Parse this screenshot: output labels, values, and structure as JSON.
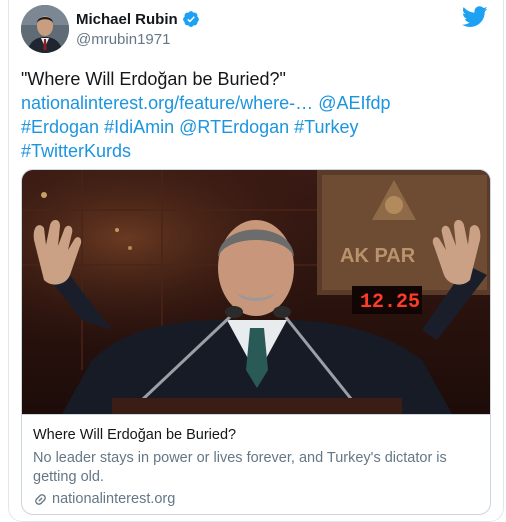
{
  "author": {
    "display_name": "Michael Rubin",
    "handle": "@mrubin1971",
    "verified": true
  },
  "icons": {
    "verified": "verified-badge-icon",
    "brand": "twitter-bird-icon",
    "link": "link-icon"
  },
  "tweet": {
    "quote": "\"Where Will Erdoğan be Buried?\"",
    "url_text": "nationalinterest.org/feature/where-…",
    "mention_1": "@AEIfdp",
    "hashtag_1": "#Erdogan",
    "hashtag_2": "#IdiAmin",
    "mention_2": "@RTErdogan",
    "hashtag_3": "#Turkey",
    "hashtag_4": "#TwitterKurds"
  },
  "card": {
    "title": "Where Will Erdoğan be Buried?",
    "description": "No leader stays in power or lives forever, and Turkey's dictator is getting old.",
    "domain": "nationalinterest.org",
    "image_text": {
      "sign": "AK PAR",
      "clock": "12.25"
    }
  },
  "colors": {
    "link": "#1b95e0",
    "text": "#14171a",
    "secondary": "#657786",
    "border": "#ccd6dd",
    "verified": "#1da1f2"
  }
}
